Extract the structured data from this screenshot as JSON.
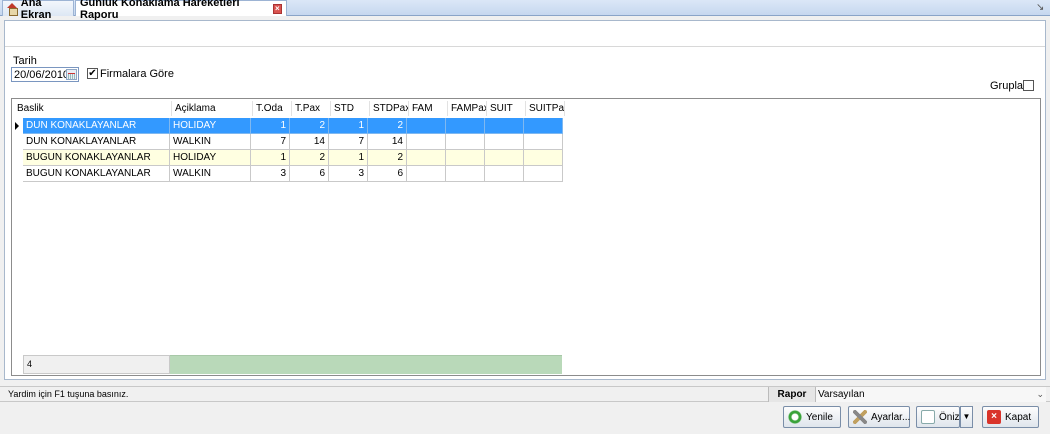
{
  "tabs": [
    {
      "label": "Ana Ekran"
    },
    {
      "label": "Günlük Konaklama Hareketleri Raporu"
    }
  ],
  "filters": {
    "date_label": "Tarih",
    "date_value": "20/06/2010",
    "firm_checkbox_label": "Firmalara Göre",
    "firm_checked": true,
    "group_label": "Grupla",
    "group_checked": false
  },
  "grid": {
    "columns": [
      "Baslik",
      "Açiklama",
      "T.Oda",
      "T.Pax",
      "STD",
      "STDPax",
      "FAM",
      "FAMPax",
      "SUIT",
      "SUITPa:"
    ],
    "rows": [
      [
        "DUN KONAKLAYANLAR",
        "HOLIDAY",
        "1",
        "2",
        "1",
        "2",
        "",
        "",
        "",
        ""
      ],
      [
        "DUN KONAKLAYANLAR",
        "WALKIN",
        "7",
        "14",
        "7",
        "14",
        "",
        "",
        "",
        ""
      ],
      [
        "BUGUN KONAKLAYANLAR",
        "HOLIDAY",
        "1",
        "2",
        "1",
        "2",
        "",
        "",
        "",
        ""
      ],
      [
        "BUGUN KONAKLAYANLAR",
        "WALKIN",
        "3",
        "6",
        "3",
        "6",
        "",
        "",
        "",
        ""
      ]
    ],
    "footer_count": "4"
  },
  "status": {
    "help_text": "Yardim için F1 tuşuna basınız.",
    "report_label": "Rapor",
    "report_value": "Varsayılan"
  },
  "buttons": {
    "refresh": "Yenile",
    "settings": "Ayarlar...",
    "preview": "Önizle",
    "close": "Kapat"
  }
}
